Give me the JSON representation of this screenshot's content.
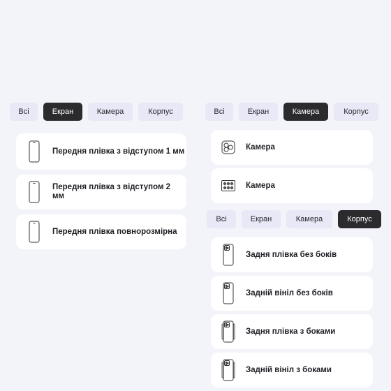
{
  "left_panel": {
    "tabs": [
      {
        "label": "Всі",
        "active": false
      },
      {
        "label": "Екран",
        "active": true
      },
      {
        "label": "Камера",
        "active": false
      },
      {
        "label": "Корпус",
        "active": false
      }
    ],
    "items": [
      {
        "label": "Передня плівка з відступом 1 мм",
        "icon": "phone-front-icon"
      },
      {
        "label": "Передня плівка з відступом 2 мм",
        "icon": "phone-front-icon"
      },
      {
        "label": "Передня плівка повнорозмірна",
        "icon": "phone-front-icon"
      }
    ]
  },
  "right_camera_panel": {
    "tabs": [
      {
        "label": "Всі",
        "active": false
      },
      {
        "label": "Екран",
        "active": false
      },
      {
        "label": "Камера",
        "active": true
      },
      {
        "label": "Корпус",
        "active": false
      }
    ],
    "items": [
      {
        "label": "Камера",
        "icon": "camera-module-round-icon"
      },
      {
        "label": "Камера",
        "icon": "camera-module-grid-icon"
      }
    ]
  },
  "right_body_panel": {
    "tabs": [
      {
        "label": "Всі",
        "active": false
      },
      {
        "label": "Екран",
        "active": false
      },
      {
        "label": "Камера",
        "active": false
      },
      {
        "label": "Корпус",
        "active": true
      }
    ],
    "items": [
      {
        "label": "Задня плівка без боків",
        "icon": "phone-back-icon"
      },
      {
        "label": "Задній вініл без боків",
        "icon": "phone-back-icon"
      },
      {
        "label": "Задня плівка з боками",
        "icon": "phone-back-sides-icon"
      },
      {
        "label": "Задній вініл з боками",
        "icon": "phone-back-sides-icon"
      }
    ]
  },
  "colors": {
    "background": "#f3f3fa",
    "tab": "#e8e8f6",
    "tab_active": "#2b2b2e",
    "card": "#ffffff"
  }
}
